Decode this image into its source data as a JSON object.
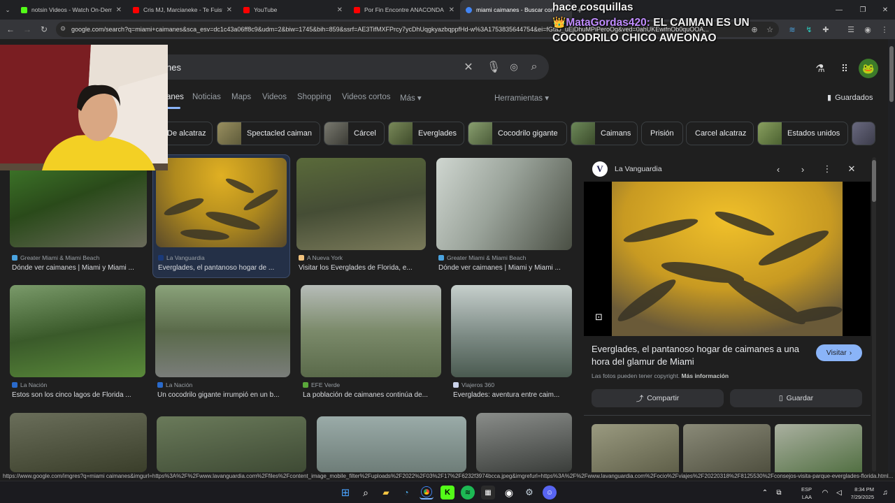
{
  "browser": {
    "tabs": [
      {
        "title": "notsin Videos - Watch On-Dem...",
        "favicon_color": "#53fc18"
      },
      {
        "title": "Cris MJ, Marcianeke - Te Fuiste...",
        "favicon_color": "#ff0000"
      },
      {
        "title": "YouTube",
        "favicon_color": "#ff0000"
      },
      {
        "title": "Por Fin Encontre ANACONDA G...",
        "favicon_color": "#ff0000"
      },
      {
        "title": "miami caimanes - Buscar con G...",
        "favicon_color": "#4285f4"
      }
    ],
    "url": "google.com/search?q=miami+caimanes&sca_esv=dc1c43a06ff8c9&udm=2&biw=1745&bih=859&ssrf=AE3TifMXFPrcy7ycDhUqgkyazbqppfHd-w%3A1753835644754&ei=fGtaJ_uEjDhuMPiPeroOg&ved=0ahUKEwifnOb0quOOA..."
  },
  "overlay": {
    "line1": "hace cosquillas",
    "username": "MataGordas420:",
    "message": "EL CAIMAN ES UN COCODRILO CHICO AWEONAO",
    "crown": "👑"
  },
  "search": {
    "query": "nes"
  },
  "nav_tabs": [
    "anes",
    "Noticias",
    "Maps",
    "Videos",
    "Shopping",
    "Videos cortos",
    "Más ▾"
  ],
  "tools_label": "Herramientas ▾",
  "saved_label": "Guardados",
  "chips": [
    {
      "label": "De alcatraz",
      "thumb": false
    },
    {
      "label": "Spectacled caiman",
      "thumb": true,
      "color": "#7c7a52"
    },
    {
      "label": "Cárcel",
      "thumb": true,
      "color": "#5a5a52"
    },
    {
      "label": "Everglades",
      "thumb": true,
      "color": "#5d6b4a"
    },
    {
      "label": "Cocodrilo gigante",
      "thumb": true,
      "color": "#6d7a58"
    },
    {
      "label": "Caimans",
      "thumb": true,
      "color": "#5b6e48"
    },
    {
      "label": "Prisión",
      "thumb": false
    },
    {
      "label": "Carcel alcatraz",
      "thumb": false
    },
    {
      "label": "Estados unidos",
      "thumb": true,
      "color": "#6e8a4a"
    }
  ],
  "results": [
    {
      "source": "Greater Miami & Miami Beach",
      "title": "Dónde ver caimanes | Miami y Miami ...",
      "color": "#2b4a22",
      "favicon": "#4aa3df"
    },
    {
      "source": "La Vanguardia",
      "title": "Everglades, el pantanoso hogar de ...",
      "color": "#8a7426",
      "favicon": "#1a3a7a"
    },
    {
      "source": "A Nueva York",
      "title": "Visitar los Everglades de Florida, e...",
      "color": "#4e5a3a",
      "favicon": "#f1c27d"
    },
    {
      "source": "Greater Miami & Miami Beach",
      "title": "Dónde ver caimanes | Miami y Miami ...",
      "color": "#9aa39a",
      "favicon": "#4aa3df"
    },
    {
      "source": "La Nación",
      "title": "Estos son los cinco lagos de Florida ...",
      "color": "#4a6a3a",
      "favicon": "#2a6acb"
    },
    {
      "source": "La Nación",
      "title": "Un cocodrilo gigante irrumpió en un b...",
      "color": "#6d7a62",
      "favicon": "#2a6acb"
    },
    {
      "source": "EFE Verde",
      "title": "La población de caimanes continúa de...",
      "color": "#7b8a6a",
      "favicon": "#5aa83a"
    },
    {
      "source": "Viajeros 360",
      "title": "Everglades: aventura entre caim...",
      "color": "#7c8a84",
      "favicon": "#cbd3ea"
    },
    {
      "source": "",
      "title": "",
      "color": "#5a5e4a",
      "favicon": ""
    },
    {
      "source": "",
      "title": "",
      "color": "#4e5a44",
      "favicon": ""
    },
    {
      "source": "",
      "title": "",
      "color": "#6e7d78",
      "favicon": ""
    },
    {
      "source": "",
      "title": "",
      "color": "#6a6d6a",
      "favicon": ""
    }
  ],
  "panel": {
    "source": "La Vanguardia",
    "logo_letter": "V",
    "title": "Everglades, el pantanoso hogar de caimanes a una hora del glamur de Miami",
    "visit_label": "Visitar",
    "copyright_text": "Las fotos pueden tener copyright.",
    "more_info": "Más información",
    "share_label": "Compartir",
    "save_label": "Guardar"
  },
  "status_url": "https://www.google.com/imgres?q=miami caimanes&imgurl=https%3A%2F%2Fwww.lavanguardia.com%2Ffiles%2Fcontent_image_mobile_filter%2Fuploads%2F2022%2F03%2F17%2F6232f3974bcca.jpeg&imgrefurl=https%3A%2F%2Fwww.lavanguardia.com%2Focio%2Fviajes%2F20220318%2F8125530%2Fconsejos-visita-parque-everglades-florida.html...",
  "taskbar": {
    "lang1": "ESP",
    "lang2": "LAA",
    "time": "8:34 PM",
    "date": "7/29/2025"
  }
}
